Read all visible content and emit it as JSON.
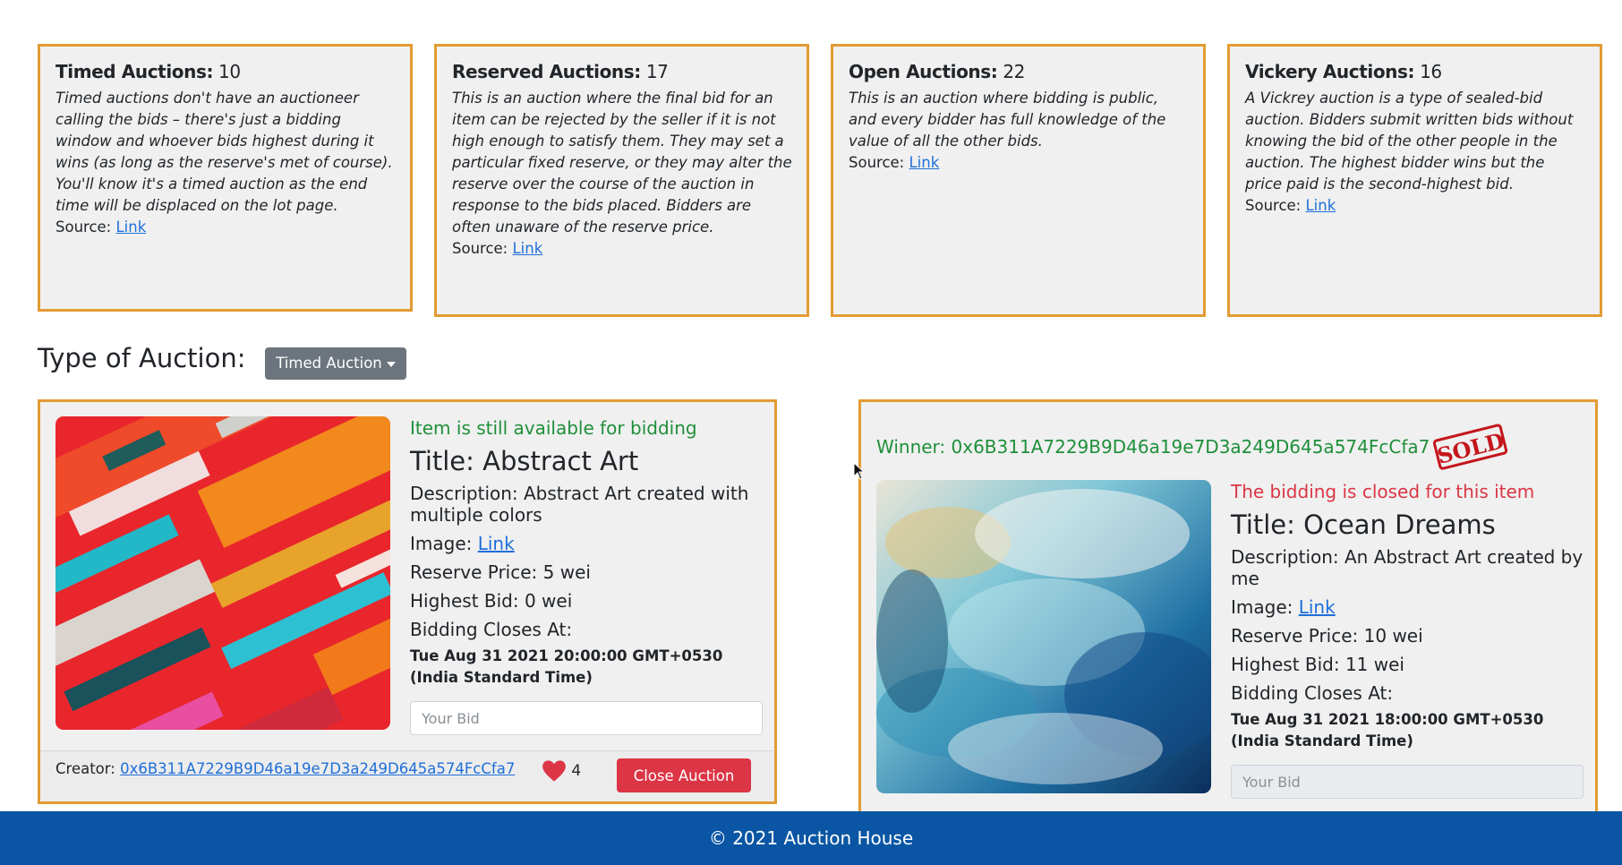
{
  "info_cards": [
    {
      "title": "Timed Auctions:",
      "count": "10",
      "description": "Timed auctions don't have an auctioneer calling the bids – there's just a bidding window and whoever bids highest during it wins (as long as the reserve's met of course). You'll know it's a timed auction as the end time will be displaced on the lot page.",
      "source_label": "Source:",
      "link_text": "Link"
    },
    {
      "title": "Reserved Auctions:",
      "count": "17",
      "description": "This is an auction where the final bid for an item can be rejected by the seller if it is not high enough to satisfy them. They may set a particular fixed reserve, or they may alter the reserve over the course of the auction in response to the bids placed. Bidders are often unaware of the reserve price.",
      "source_label": "Source:",
      "link_text": "Link"
    },
    {
      "title": "Open Auctions:",
      "count": "22",
      "description": "This is an auction where bidding is public, and every bidder has full knowledge of the value of all the other bids.",
      "source_label": "Source:",
      "link_text": "Link"
    },
    {
      "title": "Vickery Auctions:",
      "count": "16",
      "description": "A Vickrey auction is a type of sealed-bid auction. Bidders submit written bids without knowing the bid of the other people in the auction. The highest bidder wins but the price paid is the second-highest bid.",
      "source_label": "Source:",
      "link_text": "Link"
    }
  ],
  "type_selector": {
    "label": "Type of Auction:",
    "selected": "Timed Auction"
  },
  "items": [
    {
      "status": "Item is still available for bidding",
      "title": "Title: Abstract Art",
      "description": "Description: Abstract Art created with multiple colors",
      "image_label": "Image:",
      "image_link": "Link",
      "reserve": "Reserve Price: 5 wei",
      "highest_bid": "Highest Bid: 0 wei",
      "closes_label": "Bidding Closes At:",
      "closes_at": "Tue Aug 31 2021 20:00:00 GMT+0530 (India Standard Time)",
      "bid_placeholder": "Your Bid",
      "creator_label": "Creator:",
      "creator_address": "0x6B311A7229B9D46a19e7D3a249D645a574FcCfa7",
      "likes": "4",
      "close_button": "Close Auction"
    },
    {
      "winner": "Winner: 0x6B311A7229B9D46a19e7D3a249D645a574FcCfa7",
      "sold_badge": "SOLD",
      "status": "The bidding is closed for this item",
      "title": "Title: Ocean Dreams",
      "description": "Description: An Abstract Art created by me",
      "image_label": "Image:",
      "image_link": "Link",
      "reserve": "Reserve Price: 10 wei",
      "highest_bid": "Highest Bid: 11 wei",
      "closes_label": "Bidding Closes At:",
      "closes_at": "Tue Aug 31 2021 18:00:00 GMT+0530 (India Standard Time)",
      "bid_placeholder": "Your Bid"
    }
  ],
  "footer": {
    "text": "© 2021 Auction House"
  },
  "colors": {
    "card_border": "#e39b33",
    "card_bg": "#f0f0f0",
    "available": "#1f8f3a",
    "closed": "#dc3545",
    "footer_bg": "#0a56a4",
    "button_gray": "#6c757d"
  }
}
